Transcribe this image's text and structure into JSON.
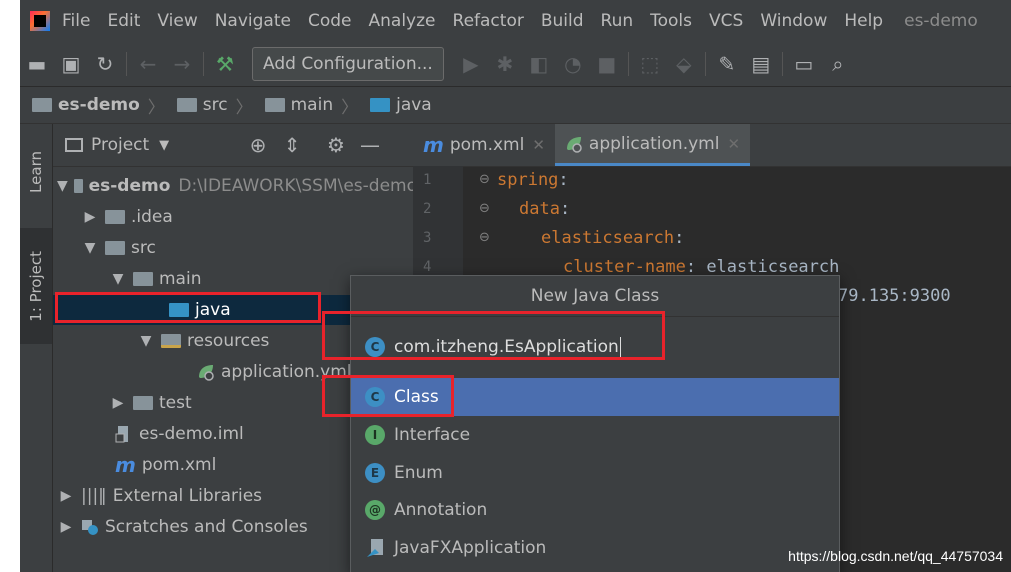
{
  "menubar": {
    "items": [
      "File",
      "Edit",
      "View",
      "Navigate",
      "Code",
      "Analyze",
      "Refactor",
      "Build",
      "Run",
      "Tools",
      "VCS",
      "Window",
      "Help"
    ],
    "project_title": "es-demo"
  },
  "toolbar": {
    "add_configuration": "Add Configuration..."
  },
  "breadcrumb": [
    "es-demo",
    "src",
    "main",
    "java"
  ],
  "stripe": {
    "learn": "Learn",
    "project": "1: Project"
  },
  "panel": {
    "title": "Project"
  },
  "tree": {
    "root": "es-demo",
    "root_path": "D:\\IDEAWORK\\SSM\\es-demo",
    "idea": ".idea",
    "src": "src",
    "main": "main",
    "java": "java",
    "resources": "resources",
    "application": "application.yml",
    "test": "test",
    "iml": "es-demo.iml",
    "pom": "pom.xml",
    "ext_libs": "External Libraries",
    "scratches": "Scratches and Consoles"
  },
  "editor": {
    "tabs": [
      {
        "label": "pom.xml",
        "active": false
      },
      {
        "label": "application.yml",
        "active": true
      }
    ],
    "line_numbers": [
      "1",
      "2",
      "3",
      "4"
    ],
    "lines": [
      {
        "key": "spring",
        "sep": ":",
        "value": ""
      },
      {
        "key": "data",
        "sep": ":",
        "value": ""
      },
      {
        "key": "elasticsearch",
        "sep": ":",
        "value": ""
      },
      {
        "key": "cluster-name",
        "sep": ": ",
        "value": "elasticsearch"
      }
    ],
    "line5_tail": "79.135:9300"
  },
  "popup": {
    "title": "New Java Class",
    "input_value": "com.itzheng.EsApplication",
    "items": [
      {
        "label": "Class",
        "icon": "C",
        "selected": true
      },
      {
        "label": "Interface",
        "icon": "I",
        "selected": false
      },
      {
        "label": "Enum",
        "icon": "E",
        "selected": false
      },
      {
        "label": "Annotation",
        "icon": "@",
        "selected": false
      },
      {
        "label": "JavaFXApplication",
        "icon": "fx",
        "selected": false
      }
    ]
  },
  "watermark": "https://blog.csdn.net/qq_44757034",
  "colors": {
    "highlight": "#e8232b",
    "selection": "#4b6eaf",
    "keyword": "#cc7832"
  }
}
